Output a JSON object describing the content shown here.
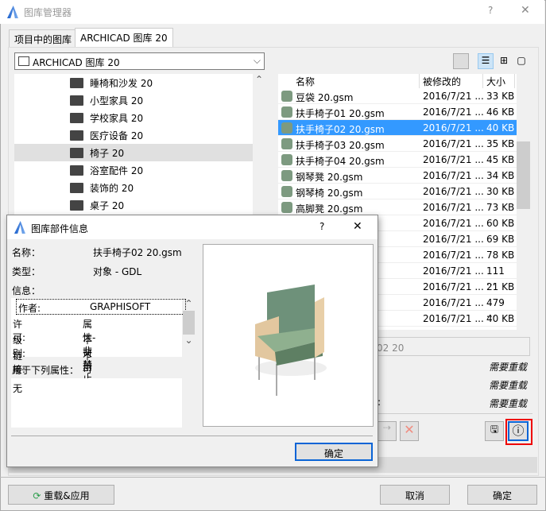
{
  "window": {
    "title": "图库管理器",
    "help": "?",
    "close": "✕"
  },
  "tabs": [
    {
      "label": "项目中的图库"
    },
    {
      "label": "ARCHICAD 图库 20"
    }
  ],
  "library_combo": {
    "value": "ARCHICAD 图库 20"
  },
  "tree": [
    {
      "label": "睡椅和沙发 20"
    },
    {
      "label": "小型家具 20"
    },
    {
      "label": "学校家具 20"
    },
    {
      "label": "医疗设备 20"
    },
    {
      "label": "椅子 20",
      "selected": true
    },
    {
      "label": "浴室配件 20"
    },
    {
      "label": "装饰的 20"
    },
    {
      "label": "桌子 20"
    }
  ],
  "list": {
    "columns": [
      "名称",
      "被修改的",
      "大小"
    ],
    "rows": [
      {
        "name": "豆袋 20.gsm",
        "date": "2016/7/21 ...",
        "size": "33 KB"
      },
      {
        "name": "扶手椅子01 20.gsm",
        "date": "2016/7/21 ...",
        "size": "46 KB"
      },
      {
        "name": "扶手椅子02 20.gsm",
        "date": "2016/7/21 ...",
        "size": "40 KB",
        "selected": true
      },
      {
        "name": "扶手椅子03 20.gsm",
        "date": "2016/7/21 ...",
        "size": "35 KB"
      },
      {
        "name": "扶手椅子04 20.gsm",
        "date": "2016/7/21 ...",
        "size": "45 KB"
      },
      {
        "name": "钢琴凳 20.gsm",
        "date": "2016/7/21 ...",
        "size": "34 KB"
      },
      {
        "name": "钢琴椅 20.gsm",
        "date": "2016/7/21 ...",
        "size": "30 KB"
      },
      {
        "name": "高脚凳 20.gsm",
        "date": "2016/7/21 ...",
        "size": "73 KB"
      },
      {
        "name": "",
        "date": "2016/7/21 ...",
        "size": "60 KB"
      },
      {
        "name": "",
        "date": "2016/7/21 ...",
        "size": "69 KB"
      },
      {
        "name": "",
        "date": "2016/7/21 ...",
        "size": "78 KB"
      },
      {
        "name": "n",
        "date": "2016/7/21 ...",
        "size": "111 ..."
      },
      {
        "name": "",
        "date": "2016/7/21 ...",
        "size": "21 KB"
      },
      {
        "name": "m",
        "date": "2016/7/21 ...",
        "size": "479 ..."
      },
      {
        "name": "m",
        "date": "2016/7/21 ...",
        "size": "40 KB"
      }
    ]
  },
  "details": {
    "name_field": "子02 20",
    "status": [
      "需要重载",
      "需要重载",
      "需要重载"
    ],
    "colon": ":"
  },
  "footer": {
    "reload": "重载&应用",
    "cancel": "取消",
    "ok": "确定"
  },
  "info_dialog": {
    "title": "图库部件信息",
    "help": "?",
    "close": "✕",
    "name_label": "名称：",
    "name_value": "扶手椅子02 20.gsm",
    "type_label": "类型：",
    "type_value": "对象 - GDL",
    "info_label": "信息：",
    "info": [
      {
        "k": "作者:",
        "v": "GRAPHISOFT"
      },
      {
        "k": "许可:",
        "v": "属性-非禁止 3.0"
      },
      {
        "k": "级别:",
        "v": "不可用"
      },
      {
        "k": "链接:",
        "v": "不可用"
      }
    ],
    "used_label": "用于下列属性：",
    "used_value": "无",
    "ok": "确定"
  }
}
